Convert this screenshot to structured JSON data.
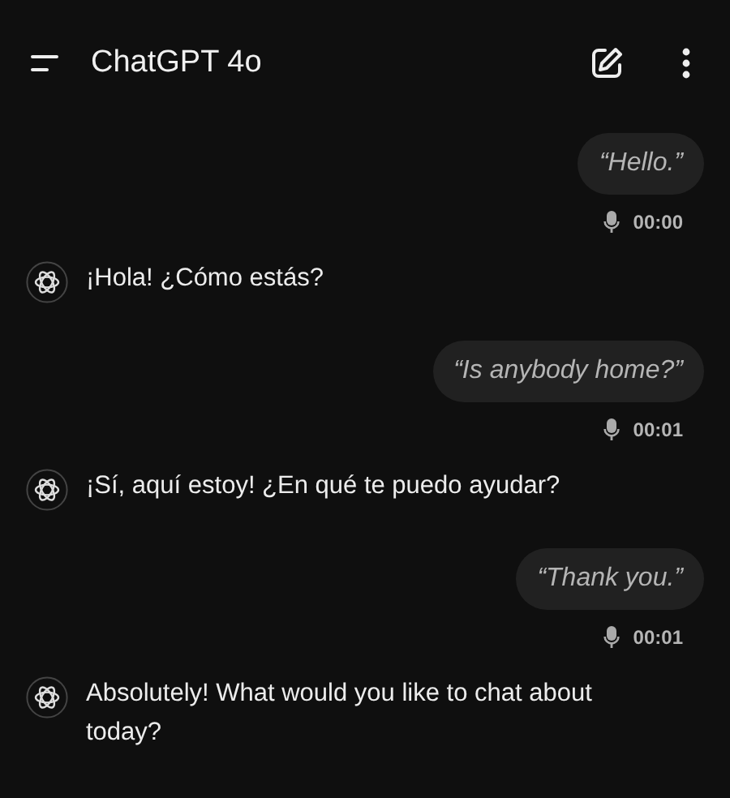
{
  "header": {
    "title": "ChatGPT 4o"
  },
  "messages": [
    {
      "kind": "user",
      "text": "“Hello.”",
      "duration": "00:00"
    },
    {
      "kind": "assistant",
      "text": "¡Hola! ¿Cómo estás?"
    },
    {
      "kind": "user",
      "text": "“Is anybody home?”",
      "duration": "00:01"
    },
    {
      "kind": "assistant",
      "text": "¡Sí, aquí estoy! ¿En qué te puedo ayudar?"
    },
    {
      "kind": "user",
      "text": "“Thank you.”",
      "duration": "00:01"
    },
    {
      "kind": "assistant",
      "text": "Absolutely! What would you like to chat about today?"
    }
  ]
}
